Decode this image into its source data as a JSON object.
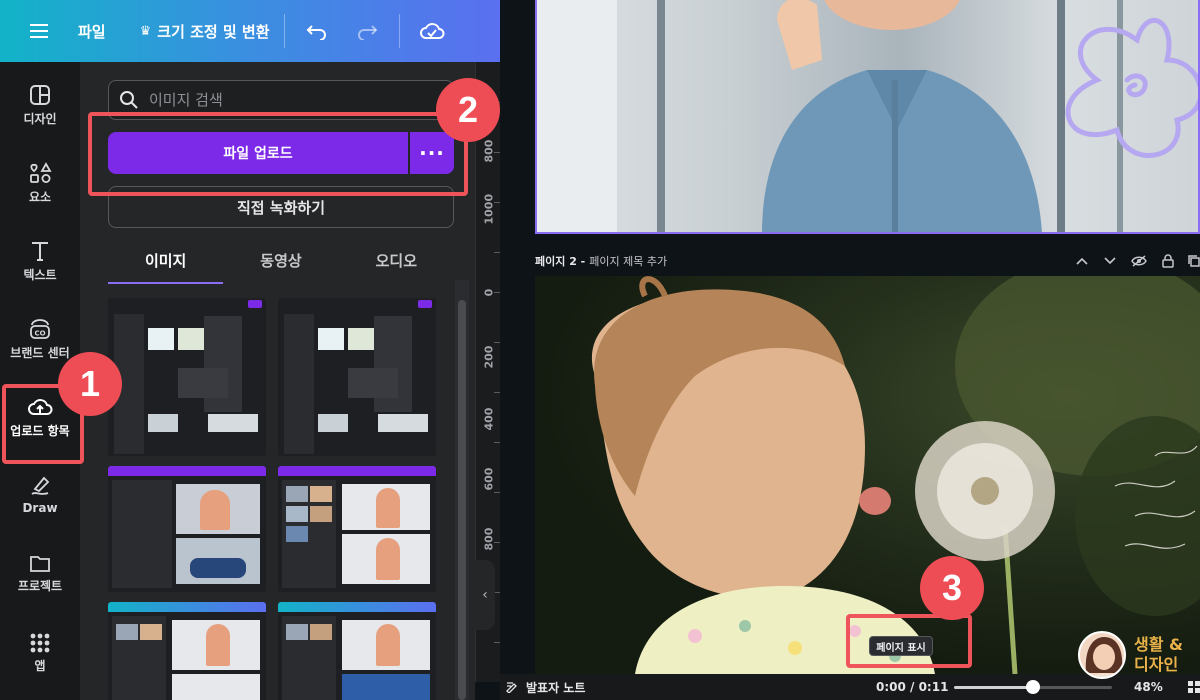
{
  "topbar": {
    "menu_label": "파일",
    "resize_label": "크기 조정 및 변환"
  },
  "rail": {
    "items": [
      {
        "label": "디자인",
        "icon": "design-icon"
      },
      {
        "label": "요소",
        "icon": "elements-icon"
      },
      {
        "label": "텍스트",
        "icon": "text-icon"
      },
      {
        "label": "브랜드 센터",
        "icon": "brand-icon"
      },
      {
        "label": "업로드 항목",
        "icon": "cloud-upload-icon"
      },
      {
        "label": "Draw",
        "icon": "draw-icon"
      },
      {
        "label": "프로젝트",
        "icon": "folder-icon"
      },
      {
        "label": "앱",
        "icon": "apps-icon"
      }
    ]
  },
  "panel": {
    "search_placeholder": "이미지 검색",
    "upload_button": "파일 업로드",
    "more_button": "···",
    "record_button": "직접 녹화하기",
    "tabs": [
      "이미지",
      "동영상",
      "오디오"
    ],
    "active_tab": "이미지"
  },
  "ruler": {
    "labels": [
      "800",
      "1000",
      "0",
      "200",
      "400",
      "600",
      "800"
    ]
  },
  "page2": {
    "title_prefix": "페이지 2 -",
    "title_placeholder": "페이지 제목 추가"
  },
  "tooltip": "페이지 표시",
  "bottombar": {
    "notes_label": "발표자 노트",
    "time": "0:00 / 0:11",
    "timeline_progress": 0.5,
    "zoom": "48%"
  },
  "badges": [
    "1",
    "2",
    "3"
  ],
  "watermark": {
    "line1": "생활 &",
    "line2": "디자인"
  },
  "colors": {
    "accent": "#7d2ae8",
    "highlight": "#ef4d55",
    "selection": "#8b6df5"
  }
}
